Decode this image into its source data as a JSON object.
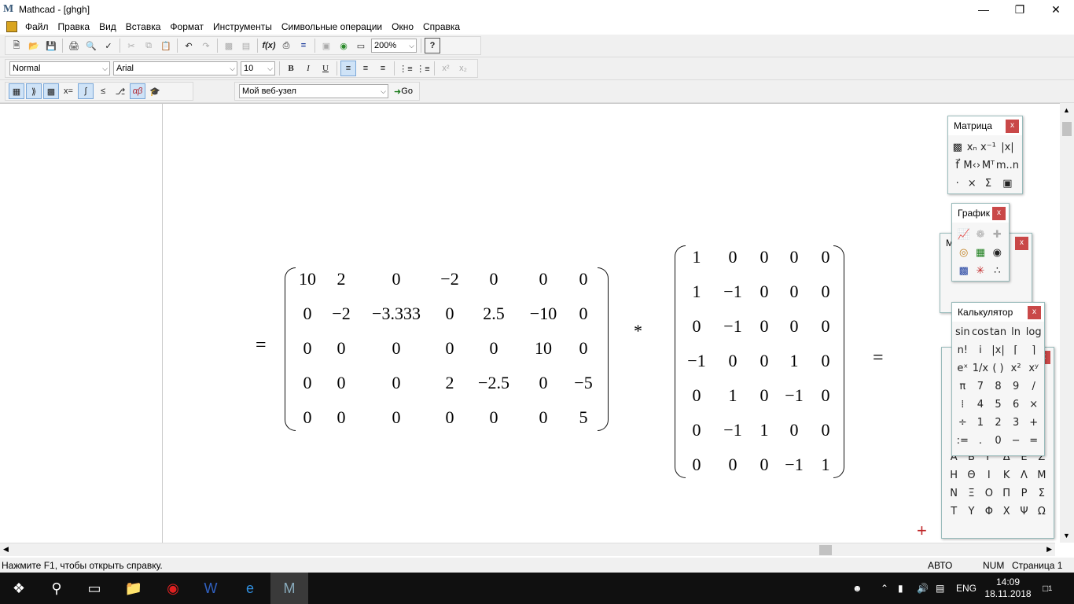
{
  "window": {
    "title": "Mathcad - [ghgh]",
    "logo": "M"
  },
  "menu": [
    "Файл",
    "Правка",
    "Вид",
    "Вставка",
    "Формат",
    "Инструменты",
    "Символьные операции",
    "Окно",
    "Справка"
  ],
  "toolbar": {
    "zoom": "200%",
    "style": "Normal",
    "font": "Arial",
    "font_size": "10",
    "bold": "B",
    "italic": "I",
    "underline": "U",
    "web_location": "Мой веб-узел",
    "go_label": "Go"
  },
  "document": {
    "eq_left": "=",
    "multiply": "*",
    "eq_right": "=",
    "matrix_a": [
      [
        "10",
        "2",
        "0",
        "−2",
        "0",
        "0",
        "0"
      ],
      [
        "0",
        "−2",
        "−3.333",
        "0",
        "2.5",
        "−10",
        "0"
      ],
      [
        "0",
        "0",
        "0",
        "0",
        "0",
        "10",
        "0"
      ],
      [
        "0",
        "0",
        "0",
        "2",
        "−2.5",
        "0",
        "−5"
      ],
      [
        "0",
        "0",
        "0",
        "0",
        "0",
        "0",
        "5"
      ]
    ],
    "matrix_b": [
      [
        "1",
        "0",
        "0",
        "0",
        "0"
      ],
      [
        "1",
        "−1",
        "0",
        "0",
        "0"
      ],
      [
        "0",
        "−1",
        "0",
        "0",
        "0"
      ],
      [
        "−1",
        "0",
        "0",
        "1",
        "0"
      ],
      [
        "0",
        "1",
        "0",
        "−1",
        "0"
      ],
      [
        "0",
        "−1",
        "1",
        "0",
        "0"
      ],
      [
        "0",
        "0",
        "0",
        "−1",
        "1"
      ]
    ]
  },
  "palettes": {
    "matrix": {
      "title": "Матрица",
      "close": "x"
    },
    "graph": {
      "title": "График",
      "close": "x"
    },
    "calculator": {
      "title": "Калькулятор",
      "close": "x",
      "keys": [
        "sin",
        "cos",
        "tan",
        "ln",
        "log",
        "n!",
        "i",
        "|x|",
        "⌈",
        "⌉",
        "eˣ",
        "1/x",
        "( )",
        "x²",
        "xʸ",
        "π",
        "7",
        "8",
        "9",
        "/",
        "⁞",
        "4",
        "5",
        "6",
        "×",
        "÷",
        "1",
        "2",
        "3",
        "+",
        ":=",
        ".",
        "0",
        "−",
        "="
      ]
    },
    "greek": {
      "keys": [
        "Α",
        "Β",
        "Γ",
        "Δ",
        "Ε",
        "Ζ",
        "Η",
        "Θ",
        "Ι",
        "Κ",
        "Λ",
        "Μ",
        "Ν",
        "Ξ",
        "Ο",
        "Π",
        "Ρ",
        "Σ",
        "Τ",
        "Υ",
        "Φ",
        "Χ",
        "Ψ",
        "Ω"
      ]
    }
  },
  "status": {
    "help": "Нажмите F1, чтобы открыть справку.",
    "mode": "АВТО",
    "num": "NUM",
    "page": "Страница 1"
  },
  "taskbar": {
    "lang": "ENG",
    "time": "14:09",
    "date": "18.11.2018",
    "notif_count": "1"
  }
}
